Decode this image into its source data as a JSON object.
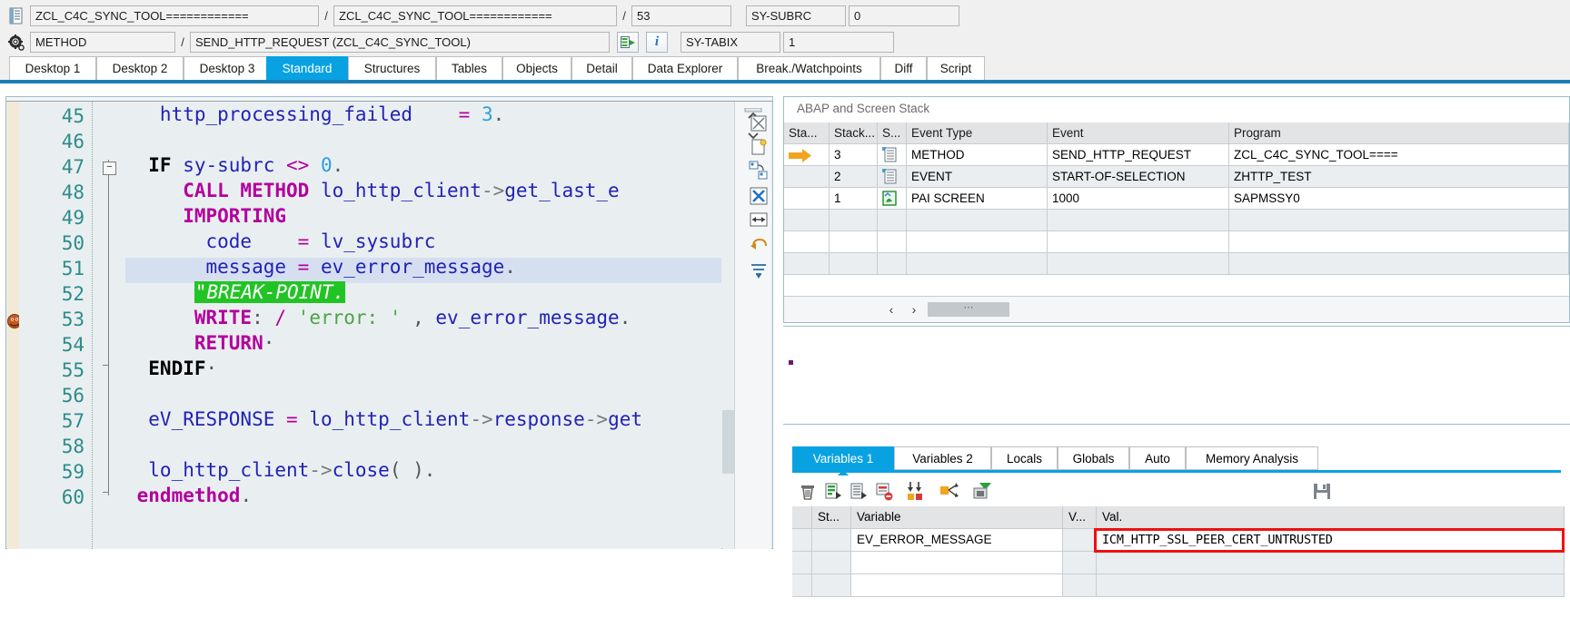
{
  "header": {
    "program_field": "ZCL_C4C_SYNC_TOOL============",
    "include_field": "ZCL_C4C_SYNC_TOOL============",
    "line_field": "53",
    "sysubrc_label": "SY-SUBRC",
    "sysubrc_value": "0",
    "event_type_field": "METHOD",
    "event_field": "SEND_HTTP_REQUEST (ZCL_C4C_SYNC_TOOL)",
    "sytabix_label": "SY-TABIX",
    "sytabix_value": "1",
    "slash": "/",
    "icons": {
      "program_icon": "program-icon",
      "method_icon": "gear-icon",
      "goto_icon": "goto-statement-icon",
      "info_icon": "info-icon"
    }
  },
  "desktop_tabs": [
    {
      "label": "Desktop 1",
      "active": false
    },
    {
      "label": "Desktop 2",
      "active": false
    },
    {
      "label": "Desktop 3",
      "active": false
    },
    {
      "label": "Standard",
      "active": true
    },
    {
      "label": "Structures",
      "active": false
    },
    {
      "label": "Tables",
      "active": false
    },
    {
      "label": "Objects",
      "active": false
    },
    {
      "label": "Detail",
      "active": false
    },
    {
      "label": "Data Explorer",
      "active": false
    },
    {
      "label": "Break./Watchpoints",
      "active": false
    },
    {
      "label": "Diff",
      "active": false
    },
    {
      "label": "Script",
      "active": false
    }
  ],
  "code": {
    "first_line_number": 45,
    "lines": [
      {
        "n": "45",
        "text": "            http_processing_failed    = 3."
      },
      {
        "n": "46",
        "text": ""
      },
      {
        "n": "47",
        "text": "    IF sy-subrc <> 0."
      },
      {
        "n": "48",
        "text": "        CALL METHOD lo_http_client->get_last_e"
      },
      {
        "n": "49",
        "text": "        IMPORTING"
      },
      {
        "n": "50",
        "text": "          code    = lv_sysubrc"
      },
      {
        "n": "51",
        "text": "          message = ev_error_message."
      },
      {
        "n": "52",
        "text": "        \"BREAK-POINT."
      },
      {
        "n": "53",
        "text": "        WRITE: / 'error: ' , ev_error_message."
      },
      {
        "n": "54",
        "text": "        RETURN."
      },
      {
        "n": "55",
        "text": "    ENDIF."
      },
      {
        "n": "56",
        "text": ""
      },
      {
        "n": "57",
        "text": "    eV_RESPONSE = lo_http_client->response->get"
      },
      {
        "n": "58",
        "text": ""
      },
      {
        "n": "59",
        "text": "    lo_http_client->close( )."
      },
      {
        "n": "60",
        "text": "  endmethod."
      }
    ],
    "highlighted_line": "51",
    "comment_line": "\"BREAK-POINT."
  },
  "stack": {
    "title": "ABAP and Screen Stack",
    "columns": [
      "Sta...",
      "Stack...",
      "S...",
      "Event Type",
      "Event",
      "Program"
    ],
    "rows": [
      {
        "status": "current-arrow",
        "stack": "3",
        "type_icon": "method-icon",
        "event_type": "METHOD",
        "event": "SEND_HTTP_REQUEST",
        "program": "ZCL_C4C_SYNC_TOOL===="
      },
      {
        "status": "",
        "stack": "2",
        "type_icon": "event-icon",
        "event_type": "EVENT",
        "event": "START-OF-SELECTION",
        "program": "ZHTTP_TEST"
      },
      {
        "status": "",
        "stack": "1",
        "type_icon": "screen-icon",
        "event_type": "PAI SCREEN",
        "event": "1000",
        "program": "SAPMSSY0"
      },
      {
        "status": "",
        "stack": "",
        "type_icon": "",
        "event_type": "",
        "event": "",
        "program": ""
      },
      {
        "status": "",
        "stack": "",
        "type_icon": "",
        "event_type": "",
        "event": "",
        "program": ""
      },
      {
        "status": "",
        "stack": "",
        "type_icon": "",
        "event_type": "",
        "event": "",
        "program": ""
      }
    ],
    "nav": {
      "prev": "‹",
      "next": "›",
      "scroll_label": "⋯"
    }
  },
  "variables": {
    "tabs": [
      {
        "label": "Variables 1",
        "active": true
      },
      {
        "label": "Variables 2",
        "active": false
      },
      {
        "label": "Locals",
        "active": false
      },
      {
        "label": "Globals",
        "active": false
      },
      {
        "label": "Auto",
        "active": false
      },
      {
        "label": "Memory Analysis",
        "active": false
      }
    ],
    "toolbar_icons": [
      "delete-icon",
      "insert-line-icon",
      "insert-row-icon",
      "delete-row-icon",
      "sort-columns-icon",
      "change-icon",
      "filter-icon",
      "save-icon"
    ],
    "columns": [
      "St...",
      "Variable",
      "V...",
      "Val."
    ],
    "rows": [
      {
        "st": "",
        "variable": "EV_ERROR_MESSAGE",
        "v": "",
        "val": "ICM_HTTP_SSL_PEER_CERT_UNTRUSTED",
        "highlighted": true
      },
      {
        "st": "",
        "variable": "",
        "v": "",
        "val": "",
        "highlighted": false
      },
      {
        "st": "",
        "variable": "",
        "v": "",
        "val": "",
        "highlighted": false
      },
      {
        "st": "",
        "variable": "",
        "v": "",
        "val": "",
        "highlighted": false
      }
    ]
  },
  "colors": {
    "accent": "#08a2e3",
    "highlight_box": "#ee1111",
    "comment_bg": "#22c425",
    "code_bg": "#e9eff0",
    "keyword": "#b3009e"
  }
}
